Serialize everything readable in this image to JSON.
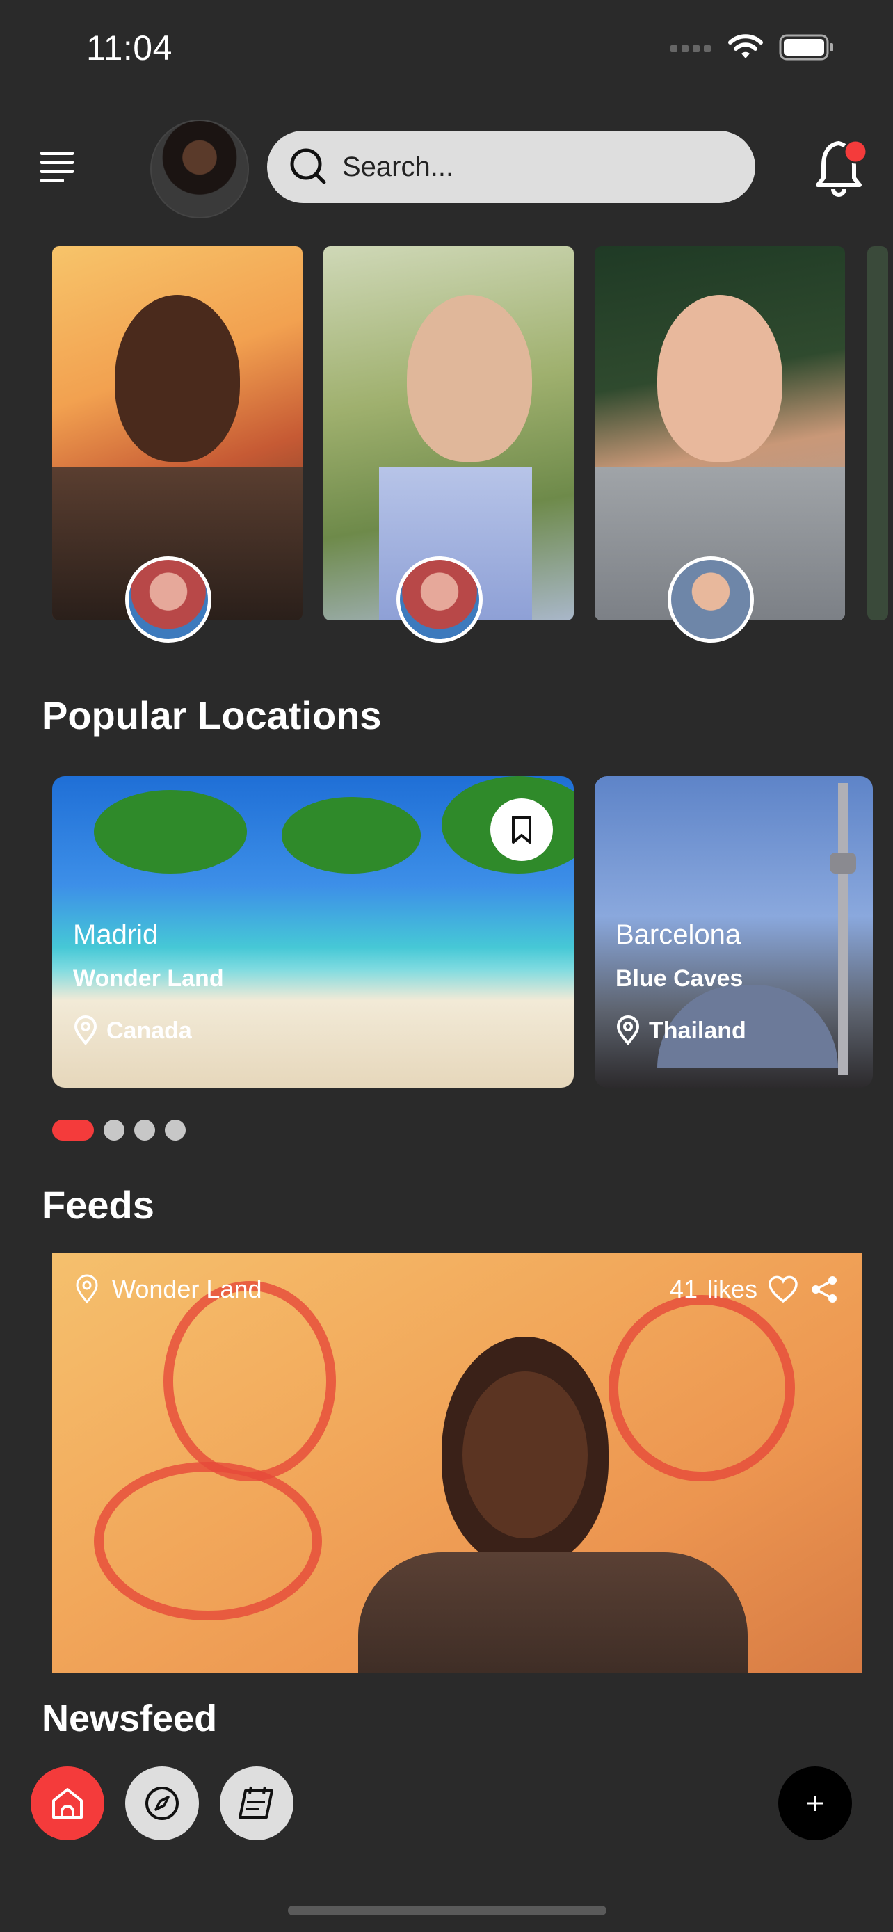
{
  "status_bar": {
    "time": "11:04"
  },
  "header": {
    "search_placeholder": "Search..."
  },
  "sections": {
    "popular_locations": "Popular Locations",
    "feeds": "Feeds",
    "newsfeed": "Newsfeed"
  },
  "locations": [
    {
      "title": "Madrid",
      "subtitle": "Wonder Land",
      "place": "Canada"
    },
    {
      "title": "Barcelona",
      "subtitle": "Blue Caves",
      "place": "Thailand"
    }
  ],
  "pager": {
    "count": 4,
    "active_index": 0
  },
  "feed": {
    "location": "Wonder Land",
    "likes_count": "41",
    "likes_label": "likes"
  },
  "colors": {
    "accent": "#f43b3b",
    "background": "#2a2a2a",
    "nav_light": "#dedede"
  },
  "icons": [
    "menu-icon",
    "search-icon",
    "bell-icon",
    "bookmark-icon",
    "location-pin-icon",
    "heart-icon",
    "share-icon",
    "home-icon",
    "compass-icon",
    "calendar-icon",
    "plus-icon",
    "wifi-icon",
    "battery-icon",
    "signal-icon"
  ]
}
